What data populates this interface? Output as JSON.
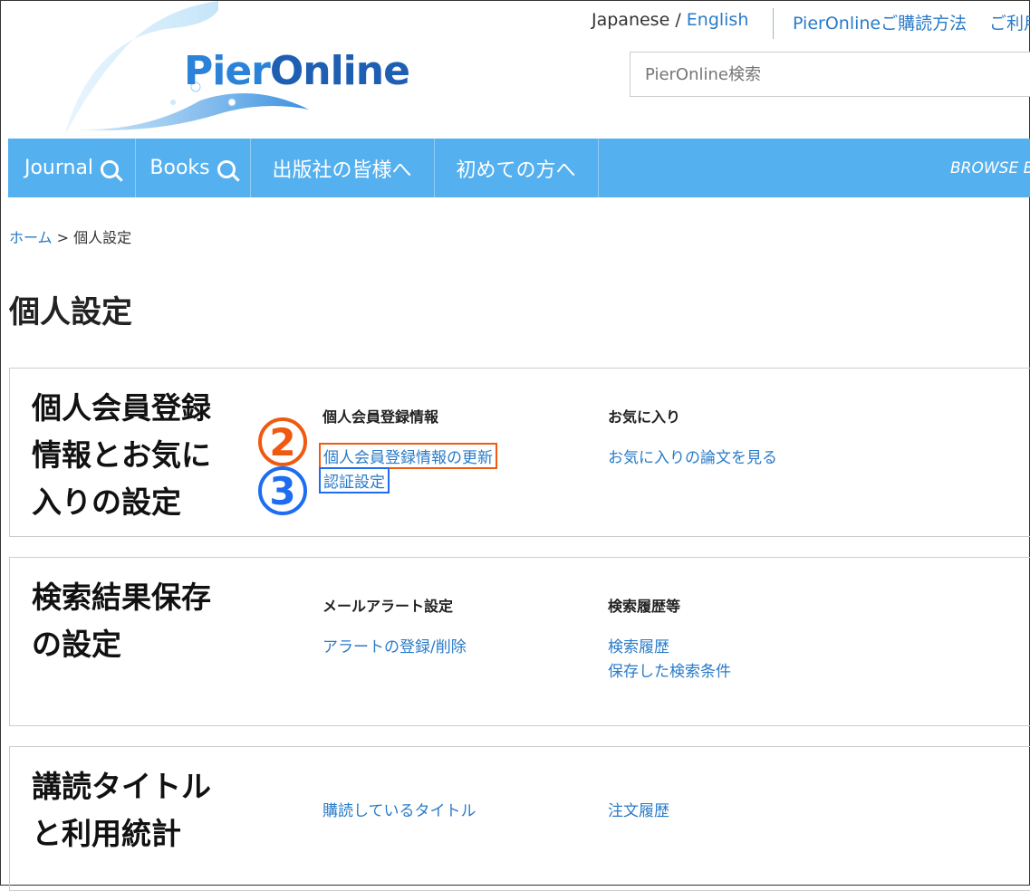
{
  "header": {
    "logo_text_a": "Pier",
    "logo_text_b": "Online",
    "lang_japanese": "Japanese",
    "lang_sep": " / ",
    "lang_english": "English",
    "howto_link": "PierOnlineご購読方法",
    "usage_link": "ご利用",
    "search_placeholder": "PierOnline検索"
  },
  "nav": {
    "journal": "Journal",
    "books": "Books",
    "publishers": "出版社の皆様へ",
    "first_time": "初めての方へ",
    "browse": "BROWSE BY"
  },
  "breadcrumb": {
    "home": "ホーム",
    "separator": ">",
    "current": "個人設定"
  },
  "page_title": "個人設定",
  "sections": [
    {
      "title": "個人会員登録\n情報とお気に\n入りの設定",
      "col1_head": "個人会員登録情報",
      "col1_links": [
        "個人会員登録情報の更新",
        "認証設定"
      ],
      "col2_head": "お気に入り",
      "col2_links": [
        "お気に入りの論文を見る"
      ]
    },
    {
      "title": "検索結果保存\nの設定",
      "col1_head": "メールアラート設定",
      "col1_links": [
        "アラートの登録/削除"
      ],
      "col2_head": "検索履歴等",
      "col2_links": [
        "検索履歴",
        "保存した検索条件"
      ]
    },
    {
      "title": "講読タイトル\nと利用統計",
      "col1_links": [
        "購読しているタイトル"
      ],
      "col2_links": [
        "注文履歴"
      ]
    }
  ],
  "annotations": {
    "badge_2": "2",
    "badge_3": "3",
    "color_orange": "#f05a10",
    "color_blue": "#1e6cf0"
  },
  "colors": {
    "nav_bg": "#55b0ef",
    "link": "#2a7bc8"
  }
}
